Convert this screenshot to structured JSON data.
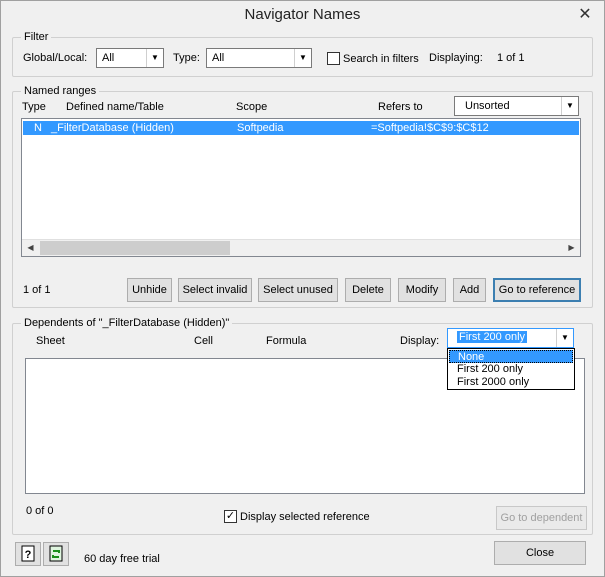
{
  "window": {
    "title": "Navigator Names",
    "close_glyph": "✕"
  },
  "filter": {
    "group_label": "Filter",
    "global_local_label": "Global/Local:",
    "global_local_value": "All",
    "type_label": "Type:",
    "type_value": "All",
    "search_in_filters_label": "Search in filters",
    "search_in_filters_checked": false,
    "displaying_label": "Displaying:",
    "displaying_value": "1 of 1"
  },
  "named_ranges": {
    "group_label": "Named ranges",
    "columns": [
      "Type",
      "Defined name/Table",
      "Scope",
      "Refers to"
    ],
    "sort_value": "Unsorted",
    "rows": [
      {
        "type": "N",
        "name": "_FilterDatabase (Hidden)",
        "scope": "Softpedia",
        "refers_to": "=Softpedia!$C$9:$C$12",
        "selected": true
      }
    ],
    "count": "1 of 1",
    "buttons": {
      "unhide": "Unhide",
      "select_invalid": "Select invalid",
      "select_unused": "Select unused",
      "delete": "Delete",
      "modify": "Modify",
      "add": "Add",
      "go_to_reference": "Go to reference"
    }
  },
  "dependents": {
    "group_label": "Dependents of \"_FilterDatabase (Hidden)\"",
    "columns": [
      "Sheet",
      "Cell",
      "Formula"
    ],
    "display_label": "Display:",
    "display_value": "First 200 only",
    "display_options": [
      "None",
      "First 200 only",
      "First 2000 only"
    ],
    "display_highlighted": "None",
    "count": "0 of 0",
    "display_selected_reference_label": "Display selected reference",
    "display_selected_reference_checked": true,
    "go_to_dependent": "Go to dependent"
  },
  "footer": {
    "help_icon": "help-icon",
    "refresh_icon": "refresh-icon",
    "trial_text": "60 day free trial",
    "close_button": "Close"
  }
}
